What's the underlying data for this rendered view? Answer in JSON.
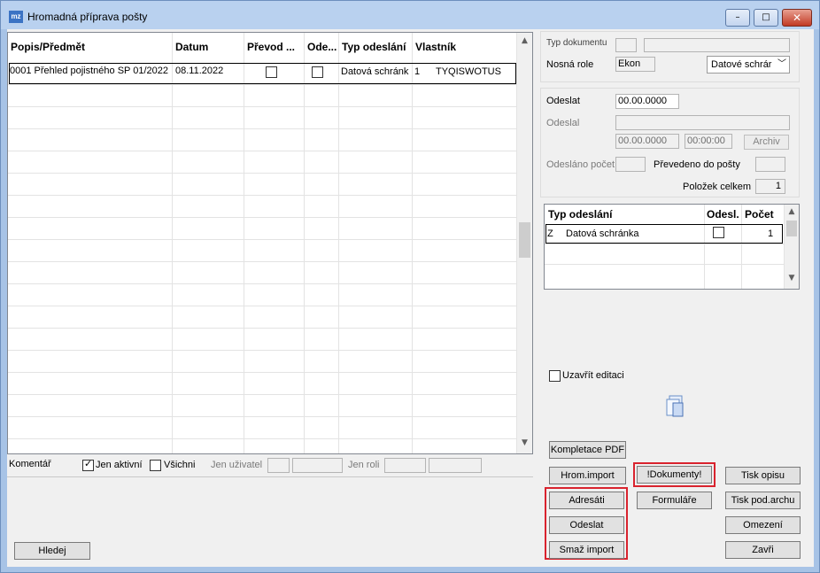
{
  "window": {
    "icon_text": "mz",
    "title": "Hromadná příprava pošty",
    "minimize_symbol": "–",
    "maximize_symbol": "□",
    "close_symbol": "✕"
  },
  "grid": {
    "columns": [
      "Popis/Předmět",
      "Datum",
      "Převod ...",
      "Ode...",
      "Typ odeslání",
      "Vlastník"
    ],
    "rows": [
      {
        "popis": "0001 Přehled pojistného SP 01/2022",
        "datum": "08.11.2022",
        "prevod": false,
        "odeslano": false,
        "typ_odeslani": "Datová schránk",
        "vlastnik_num": "1",
        "vlastnik": "TYQISWOTUS"
      }
    ]
  },
  "filters": {
    "komentar_label": "Komentář",
    "jen_aktivni_label": "Jen aktivní",
    "jen_aktivni_checked": true,
    "vsechni_label": "Všichni",
    "vsechni_checked": false,
    "jen_uzivatel_label": "Jen uživatel",
    "jen_roli_label": "Jen roli"
  },
  "hledej_label": "Hledej",
  "details": {
    "typ_dokumentu_label": "Typ dokumentu",
    "nosna_role_label": "Nosná role",
    "nosna_role_value": "Ekon",
    "nosna_select_value": "Datové schrár",
    "odeslat_label": "Odeslat",
    "odeslat_value": "00.00.0000",
    "odeslal_label": "Odeslal",
    "odeslal_date": "00.00.0000",
    "odeslal_time": "00:00:00",
    "archiv_label": "Archiv",
    "odeslano_pocet_label": "Odesláno počet",
    "prevedeno_label": "Převedeno do pošty",
    "polozek_celkem_label": "Položek celkem",
    "polozek_celkem_value": "1"
  },
  "mini_grid": {
    "columns": [
      "Typ odeslání",
      "Odesl.",
      "Počet"
    ],
    "rows": [
      {
        "code": "Z",
        "typ": "Datová schránka",
        "odesl": false,
        "pocet": "1"
      }
    ]
  },
  "uzavrit_label": "Uzavřít editaci",
  "buttons": {
    "kompletace_pdf": "Kompletace PDF",
    "hrom_import": "Hrom.import",
    "dokumenty": "!Dokumenty!",
    "tisk_opisu": "Tisk opisu",
    "adresati": "Adresáti",
    "formulare": "Formuláře",
    "tisk_pod_archu": "Tisk pod.archu",
    "odeslat": "Odeslat",
    "omezeni": "Omezení",
    "smaz_import": "Smaž import",
    "zavri": "Zavři"
  },
  "colors": {
    "highlight": "#d9232e",
    "titlebar": "#b9d1ef"
  }
}
